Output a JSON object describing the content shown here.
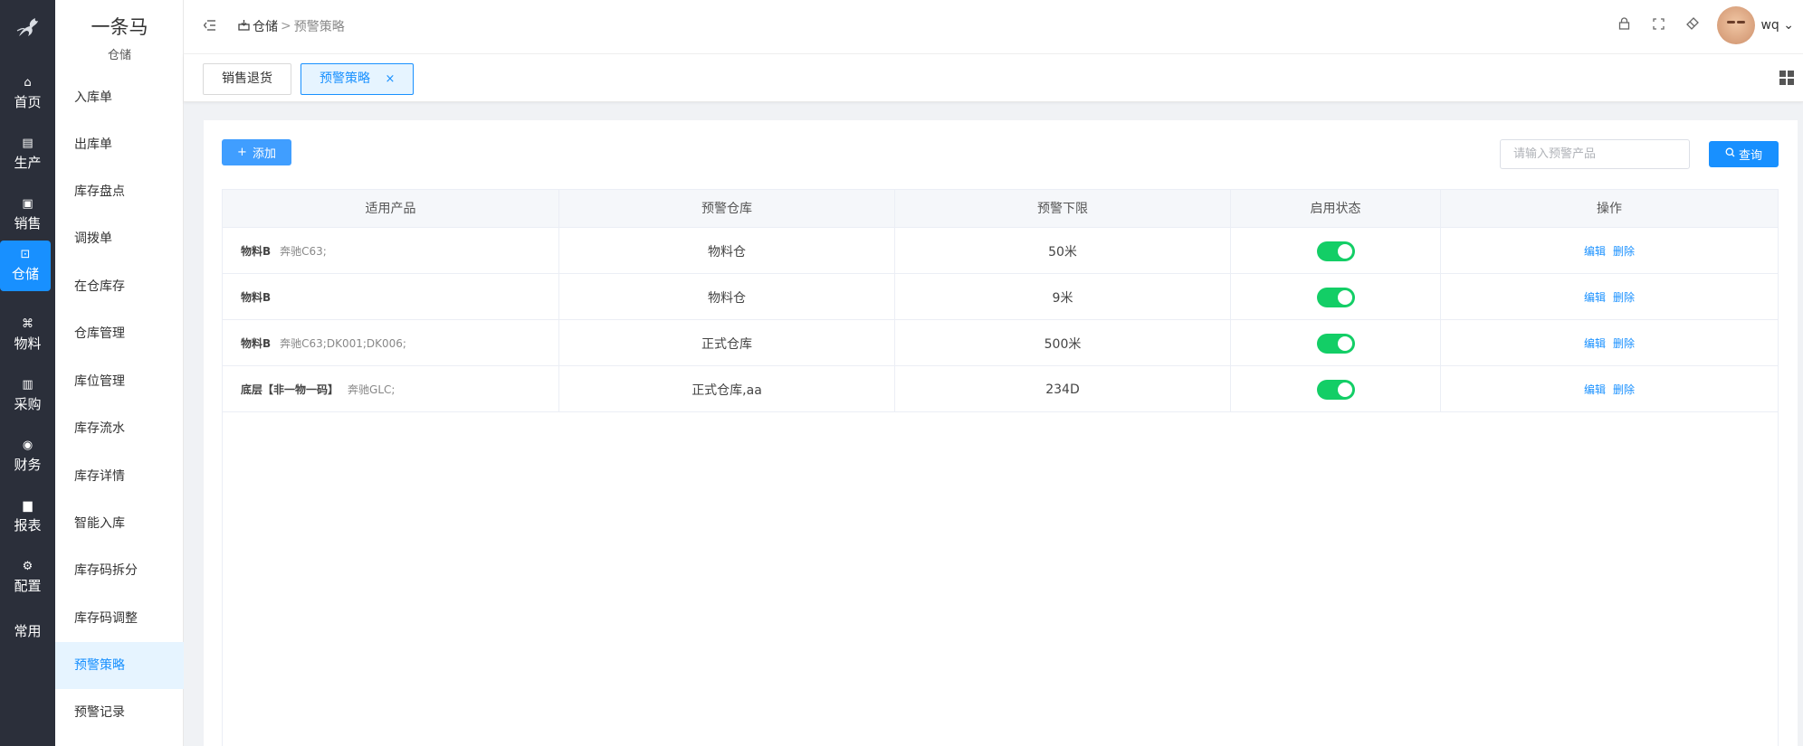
{
  "colors": {
    "rail_bg": "#2b2f3a",
    "accent": "#1890ff",
    "switch_on": "#13ce66"
  },
  "rail": {
    "items": [
      {
        "label": "首页",
        "icon": "home-icon",
        "glyph": "⌂"
      },
      {
        "label": "生产",
        "icon": "factory-icon",
        "glyph": "▤"
      },
      {
        "label": "销售",
        "icon": "sales-icon",
        "glyph": "▣"
      },
      {
        "label": "仓储",
        "icon": "warehouse-icon",
        "glyph": "⊡"
      },
      {
        "label": "物料",
        "icon": "material-icon",
        "glyph": "⌘"
      },
      {
        "label": "采购",
        "icon": "purchase-icon",
        "glyph": "▥"
      },
      {
        "label": "财务",
        "icon": "finance-icon",
        "glyph": "◉"
      },
      {
        "label": "报表",
        "icon": "report-icon",
        "glyph": "▆"
      },
      {
        "label": "配置",
        "icon": "settings-icon",
        "glyph": "⚙"
      },
      {
        "label": "常用",
        "icon": "",
        "glyph": ""
      }
    ]
  },
  "submenu": {
    "title": "一条马",
    "subtitle": "仓储",
    "items": [
      "入库单",
      "出库单",
      "库存盘点",
      "调拨单",
      "在仓库存",
      "仓库管理",
      "库位管理",
      "库存流水",
      "库存详情",
      "智能入库",
      "库存码拆分",
      "库存码调整",
      "预警策略",
      "预警记录"
    ]
  },
  "breadcrumb": {
    "section": "仓储",
    "sep": ">",
    "page": "预警策略"
  },
  "user": {
    "name": "wq"
  },
  "tabs": [
    {
      "label": "销售退货"
    },
    {
      "label": "预警策略",
      "close": "×"
    }
  ],
  "toolbar": {
    "add_label": "添加",
    "search_placeholder": "请输入预警产品",
    "search_label": "查询"
  },
  "table": {
    "headers": [
      "适用产品",
      "预警仓库",
      "预警下限",
      "启用状态",
      "操作"
    ],
    "rows": [
      {
        "product": "物料B",
        "model": "奔驰C63;",
        "warehouse": "物料仓",
        "limit": "50米",
        "enabled": true,
        "edit": "编辑",
        "delete": "删除"
      },
      {
        "product": "物料B",
        "model": "",
        "warehouse": "物料仓",
        "limit": "9米",
        "enabled": true,
        "edit": "编辑",
        "delete": "删除"
      },
      {
        "product": "物料B",
        "model": "奔驰C63;DK001;DK006;",
        "warehouse": "正式仓库",
        "limit": "500米",
        "enabled": true,
        "edit": "编辑",
        "delete": "删除"
      },
      {
        "product": "底层【非一物一码】",
        "model": "奔驰GLC;",
        "warehouse": "正式仓库,aa",
        "limit": "234D",
        "enabled": true,
        "edit": "编辑",
        "delete": "删除"
      }
    ]
  }
}
